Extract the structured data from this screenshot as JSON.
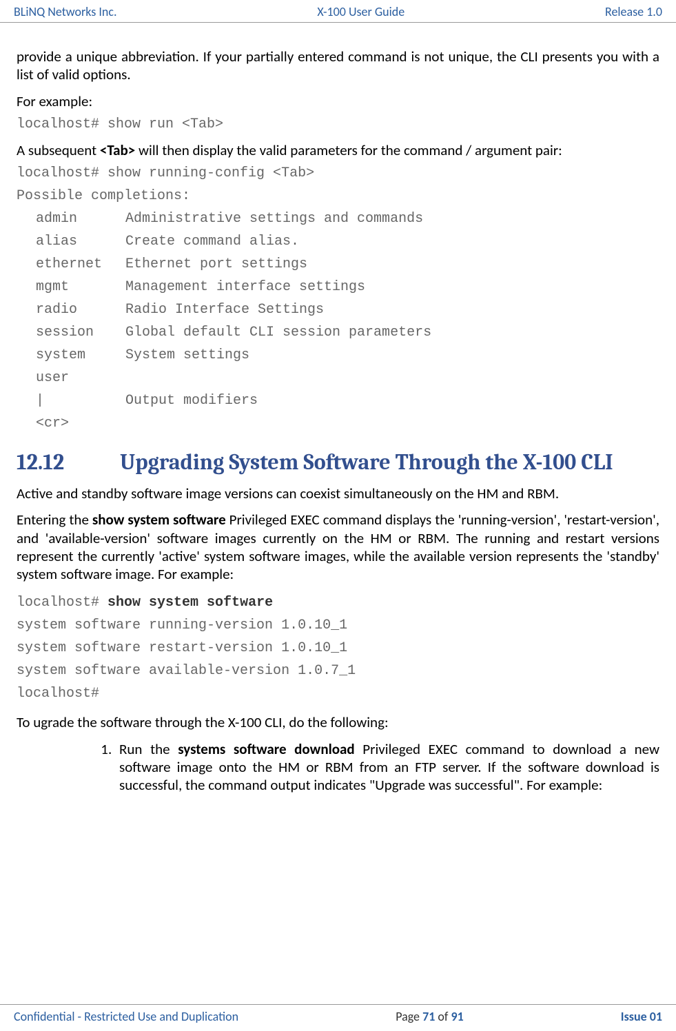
{
  "header": {
    "left": "BLiNQ Networks Inc.",
    "center": "X-100 User Guide",
    "right": "Release 1.0"
  },
  "body": {
    "p1": "provide a unique abbreviation. If your partially entered command is not unique, the CLI presents you with a list of valid options.",
    "for_example": "For example:",
    "cmd1": "localhost# show run <Tab>",
    "p2a": "A subsequent ",
    "p2_tab": "<Tab>",
    "p2b": " will then display the valid parameters for the command / argument pair:",
    "cmd2": "localhost# show running-config <Tab>",
    "possible": "Possible completions:",
    "completions": [
      {
        "k": "admin",
        "d": "Administrative settings and commands"
      },
      {
        "k": "alias",
        "d": "Create command alias."
      },
      {
        "k": "ethernet",
        "d": "Ethernet port settings"
      },
      {
        "k": "mgmt",
        "d": "Management interface settings"
      },
      {
        "k": "radio",
        "d": "Radio Interface Settings"
      },
      {
        "k": "session",
        "d": "Global default CLI session parameters"
      },
      {
        "k": "system",
        "d": "System settings"
      },
      {
        "k": "user",
        "d": ""
      },
      {
        "k": "|",
        "d": "Output modifiers"
      },
      {
        "k": "<cr>",
        "d": ""
      }
    ],
    "h2_num": "12.12",
    "h2_text": "Upgrading System Software Through the X-100 CLI",
    "p3": "Active and standby software image versions can coexist simultaneously on the HM and RBM.",
    "p4a": "Entering the ",
    "p4_cmd": "show system software",
    "p4b": " Privileged EXEC command displays the 'running-version', 'restart-version', and 'available-version' software images currently on the HM or RBM. The running and restart versions represent the currently 'active' system software images, while the available version represents the 'standby' system software image.  For example:",
    "ex_prompt": "localhost# ",
    "ex_cmd": "show system software",
    "ex_l1": "system software running-version 1.0.10_1",
    "ex_l2": "system software restart-version 1.0.10_1",
    "ex_l3": "system software available-version 1.0.7_1",
    "ex_l4": "localhost#",
    "p5": "To ugrade the software through the X-100 CLI, do the following:",
    "li1a": "Run the ",
    "li1_cmd": "systems software download",
    "li1b": " Privileged EXEC command to download a new software image onto the HM or RBM from an FTP server. If the software download is successful, the command output indicates \"Upgrade was successful\". For example:"
  },
  "footer": {
    "left": "Confidential - Restricted Use and Duplication",
    "center_a": "Page ",
    "center_page": "71",
    "center_b": " of ",
    "center_total": "91",
    "right": "Issue 01"
  }
}
